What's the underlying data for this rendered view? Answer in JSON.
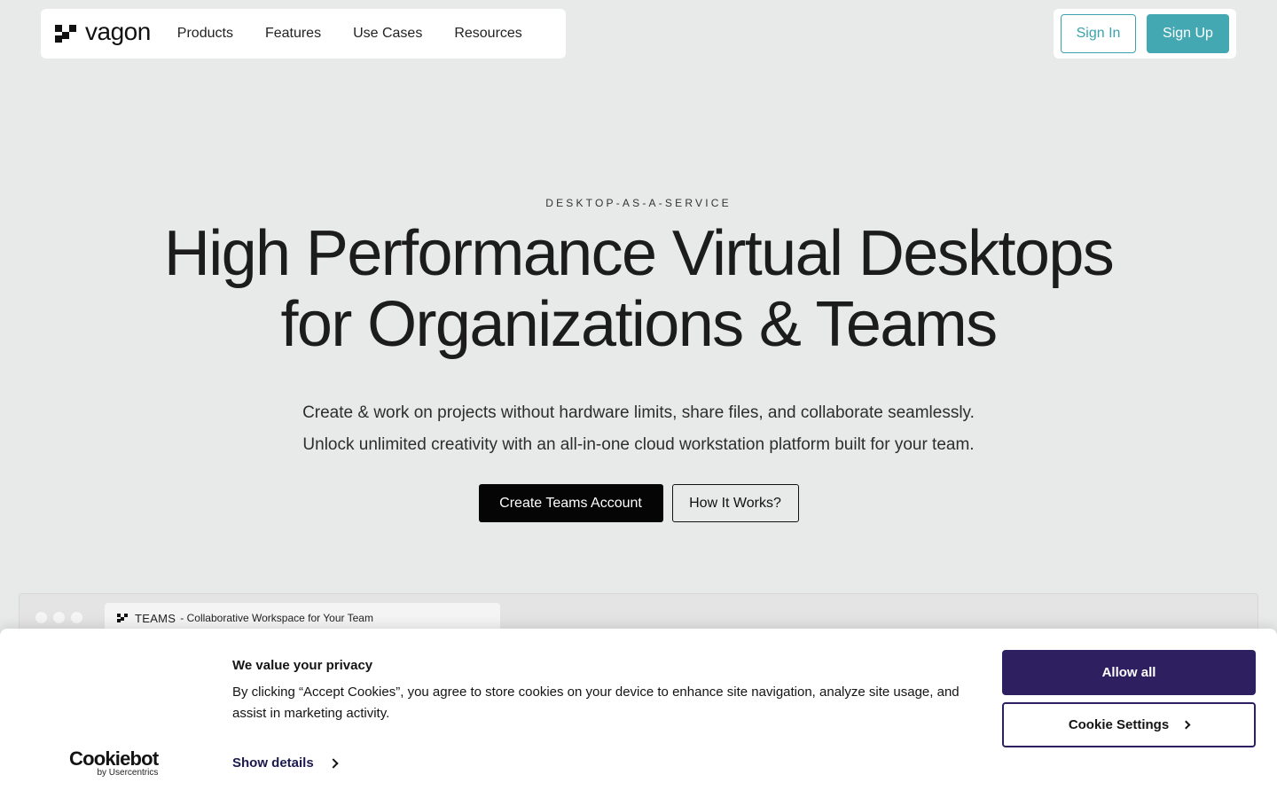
{
  "nav": {
    "brand": "vagon",
    "links": [
      "Products",
      "Features",
      "Use Cases",
      "Resources"
    ],
    "sign_in": "Sign In",
    "sign_up": "Sign Up",
    "accent_color": "#43a8b1"
  },
  "hero": {
    "eyebrow": "DESKTOP-AS-A-SERVICE",
    "title_line1": "High Performance Virtual Desktops",
    "title_line2": "for Organizations & Teams",
    "subtitle_line1": "Create & work on projects without hardware limits, share files, and collaborate seamlessly.",
    "subtitle_line2": "Unlock unlimited creativity with an all-in-one cloud workstation platform built for your team.",
    "primary_cta": "Create Teams Account",
    "secondary_cta": "How It Works?"
  },
  "preview": {
    "tab_brand": "TEAMS",
    "tab_title": "- Collaborative Workspace for Your Team"
  },
  "cookie": {
    "logo_word": "Cookiebot",
    "logo_sub": "by Usercentrics",
    "title": "We value your privacy",
    "text": "By clicking “Accept Cookies”, you agree to store cookies on your device to enhance site navigation, analyze site usage, and assist in marketing activity.",
    "show_details": "Show details",
    "allow_all": "Allow all",
    "settings": "Cookie Settings",
    "button_color": "#2e2060"
  }
}
